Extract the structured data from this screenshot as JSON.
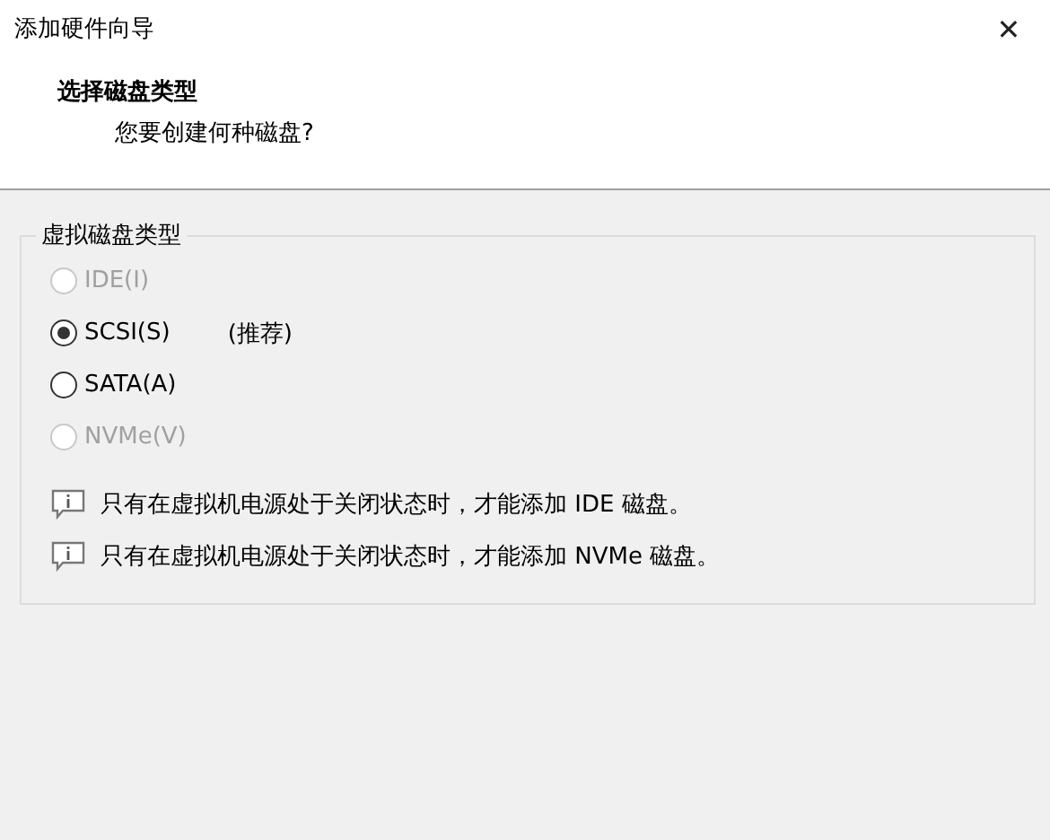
{
  "window": {
    "title": "添加硬件向导",
    "close": "✕"
  },
  "header": {
    "title": "选择磁盘类型",
    "subtitle": "您要创建何种磁盘?"
  },
  "group": {
    "title": "虚拟磁盘类型",
    "options": [
      {
        "label": "IDE(I)",
        "selected": false,
        "disabled": true
      },
      {
        "label": "SCSI(S)",
        "selected": true,
        "disabled": false,
        "note": "(推荐)"
      },
      {
        "label": "SATA(A)",
        "selected": false,
        "disabled": false
      },
      {
        "label": "NVMe(V)",
        "selected": false,
        "disabled": true
      }
    ],
    "messages": [
      "只有在虚拟机电源处于关闭状态时，才能添加 IDE 磁盘。",
      "只有在虚拟机电源处于关闭状态时，才能添加 NVMe 磁盘。"
    ]
  }
}
